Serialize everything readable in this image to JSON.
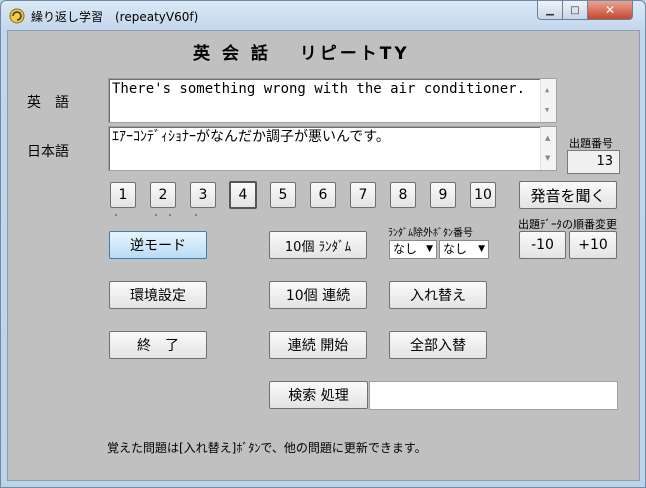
{
  "window": {
    "title": "繰り返し学習　(repeatyV60f)",
    "minimize_glyph": "▁",
    "maximize_glyph": "□",
    "close_glyph": "✕"
  },
  "main": {
    "heading": "英 会 話　 リピートTY",
    "english_label": "英　語",
    "japanese_label": "日本語",
    "english_text": "There's something wrong with the air conditioner.",
    "japanese_text": "ｴｱｰｺﾝﾃﾞｨｼｮﾅｰがなんだか調子が悪いんです。",
    "question_number_label": "出題番号",
    "question_number": "13",
    "number_buttons": [
      "1",
      "2",
      "3",
      "4",
      "5",
      "6",
      "7",
      "8",
      "9",
      "10"
    ],
    "pronounce_button": "発音を聞く",
    "random_exclude_label": "ﾗﾝﾀﾞﾑ除外ﾎﾞﾀﾝ番号",
    "select1": "なし",
    "select2": "なし",
    "order_change_label": "出題ﾃﾞｰﾀの順番変更",
    "minus10": "-10",
    "plus10": "+10",
    "reverse_mode": "逆モード",
    "settings": "環境設定",
    "exit": "終　了",
    "random10": "10個 ﾗﾝﾀﾞﾑ",
    "serial10": "10個 連続",
    "serial_start": "連続 開始",
    "replace": "入れ替え",
    "replace_all": "全部入替",
    "search": "検索 処理",
    "search_value": "",
    "footer_note": "覚えた問題は[入れ替え]ﾎﾞﾀﾝで、他の問題に更新できます。"
  }
}
